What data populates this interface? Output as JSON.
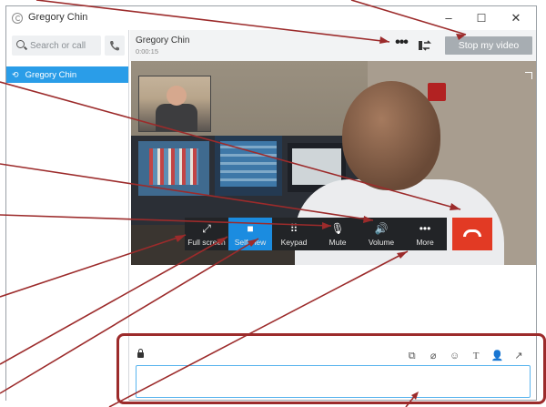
{
  "window": {
    "title": "Gregory Chin",
    "minimize_glyph": "–",
    "maximize_glyph": "☐",
    "close_glyph": "✕"
  },
  "sidebar": {
    "search_placeholder": "Search or call",
    "contacts": [
      {
        "name": "Gregory Chin",
        "selected": true
      }
    ]
  },
  "conversation": {
    "name": "Gregory Chin",
    "duration": "0:00:15",
    "more_glyph": "•••",
    "stop_video_label": "Stop my video"
  },
  "controls": [
    {
      "id": "full-screen",
      "label": "Full screen",
      "icon": "expand-arrow-icon",
      "glyph": "⤢",
      "active": false
    },
    {
      "id": "self-view",
      "label": "Self-view",
      "icon": "camera-icon",
      "glyph": "■",
      "active": true
    },
    {
      "id": "keypad",
      "label": "Keypad",
      "icon": "keypad-icon",
      "glyph": "⠿",
      "active": false
    },
    {
      "id": "mute",
      "label": "Mute",
      "icon": "microphone-icon",
      "glyph": "🎙",
      "active": false
    },
    {
      "id": "volume",
      "label": "Volume",
      "icon": "speaker-icon",
      "glyph": "🔊",
      "active": false
    },
    {
      "id": "more",
      "label": "More",
      "icon": "ellipsis-icon",
      "glyph": "•••",
      "active": false
    }
  ],
  "compose": {
    "tools": [
      {
        "id": "screenshot",
        "glyph": "⧉",
        "icon": "screen-capture-icon"
      },
      {
        "id": "attach",
        "glyph": "⌀",
        "icon": "paperclip-icon"
      },
      {
        "id": "emoji",
        "glyph": "☺",
        "icon": "emoji-icon"
      },
      {
        "id": "format",
        "glyph": "T",
        "icon": "text-format-icon"
      },
      {
        "id": "add-people",
        "glyph": "👤",
        "icon": "add-person-icon"
      },
      {
        "id": "popout",
        "glyph": "↗",
        "icon": "popout-icon"
      }
    ],
    "message": ""
  },
  "colors": {
    "accent": "#1b8ce0",
    "selected_contact": "#2a9de8",
    "hangup": "#e23a24",
    "annotation": "#9c2b2b",
    "stop_video_button": "#a7adb2"
  }
}
